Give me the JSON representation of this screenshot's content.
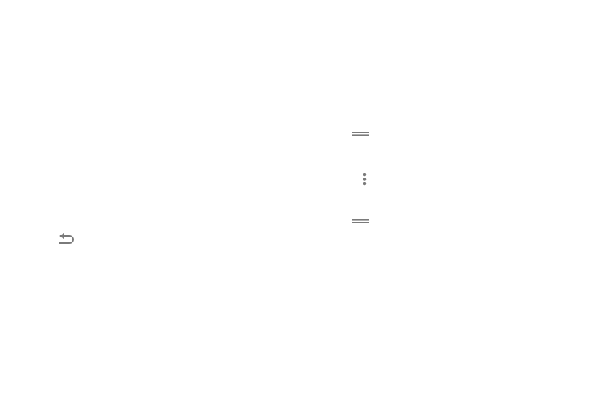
{
  "icons": {
    "back": "back-arrow-icon",
    "drag_top": "drag-handle-icon",
    "more": "more-options-vertical-icon",
    "drag_bottom": "drag-handle-icon"
  },
  "colors": {
    "background": "#ffffff",
    "icon": "#7a7a7a",
    "rule": "#bdbdbd"
  }
}
